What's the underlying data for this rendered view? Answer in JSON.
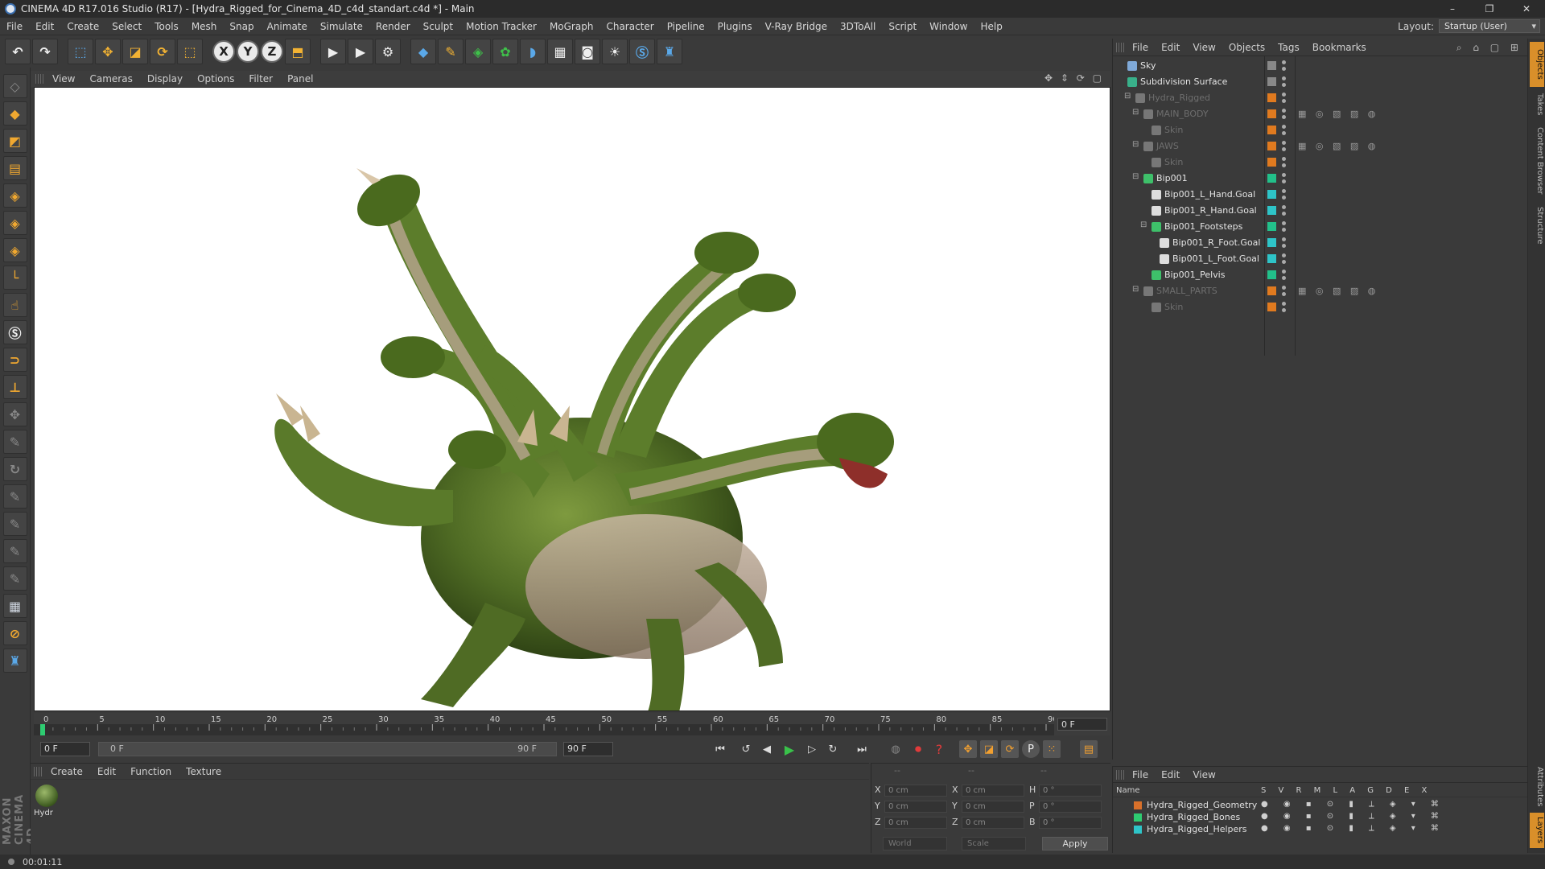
{
  "window": {
    "title": "CINEMA 4D R17.016 Studio (R17) - [Hydra_Rigged_for_Cinema_4D_c4d_standart.c4d *] - Main",
    "controls": [
      "–",
      "❐",
      "✕"
    ]
  },
  "menubar": {
    "items": [
      "File",
      "Edit",
      "Create",
      "Select",
      "Tools",
      "Mesh",
      "Snap",
      "Animate",
      "Simulate",
      "Render",
      "Sculpt",
      "Motion Tracker",
      "MoGraph",
      "Character",
      "Pipeline",
      "Plugins",
      "V-Ray Bridge",
      "3DToAll",
      "Script",
      "Window",
      "Help"
    ],
    "layout_label": "Layout:",
    "layout_value": "Startup (User)"
  },
  "toolbar": {
    "axis_x": "X",
    "axis_y": "Y",
    "axis_z": "Z"
  },
  "viewport": {
    "menu": [
      "View",
      "Cameras",
      "Display",
      "Options",
      "Filter",
      "Panel"
    ],
    "nav_icons": "✥ ⇕ ⟳ ▢"
  },
  "timeline": {
    "ticks": [
      "0",
      "5",
      "10",
      "15",
      "20",
      "25",
      "30",
      "35",
      "40",
      "45",
      "50",
      "55",
      "60",
      "65",
      "70",
      "75",
      "80",
      "85",
      "90"
    ],
    "end_frame": "0 F",
    "current_frame": "0 F",
    "range_start": "0 F",
    "range_end": "90 F",
    "max_frame": "90 F",
    "start_tick": 0,
    "end_tick": 90
  },
  "material_manager": {
    "menu": [
      "Create",
      "Edit",
      "Function",
      "Texture"
    ],
    "material_name": "Hydr"
  },
  "coordinates": {
    "rows": [
      {
        "a": "X",
        "av": "0 cm",
        "b": "X",
        "bv": "0 cm",
        "c": "H",
        "cv": "0 °"
      },
      {
        "a": "Y",
        "av": "0 cm",
        "b": "Y",
        "bv": "0 cm",
        "c": "P",
        "cv": "0 °"
      },
      {
        "a": "Z",
        "av": "0 cm",
        "b": "Z",
        "bv": "0 cm",
        "c": "B",
        "cv": "0 °"
      }
    ],
    "space": "World",
    "mode": "Scale",
    "apply": "Apply",
    "headers": [
      "--",
      "--",
      "--"
    ]
  },
  "objects": {
    "menu": [
      "File",
      "Edit",
      "View",
      "Objects",
      "Tags",
      "Bookmarks"
    ],
    "rows": [
      {
        "name": "Sky",
        "indent": 0,
        "dim": false,
        "color": "#7fa9d8",
        "tag": "#888888",
        "tags": ""
      },
      {
        "name": "Subdivision Surface",
        "indent": 0,
        "dim": false,
        "color": "#39b08a",
        "tag": "#888888",
        "tags": ""
      },
      {
        "name": "Hydra_Rigged",
        "indent": 1,
        "dim": true,
        "color": "#777777",
        "tag": "#e07a1f",
        "tags": ""
      },
      {
        "name": "MAIN_BODY",
        "indent": 2,
        "dim": true,
        "color": "#777777",
        "tag": "#e07a1f",
        "tags": "▦ ◎ ▧ ▨ ◍"
      },
      {
        "name": "Skin",
        "indent": 3,
        "dim": true,
        "color": "#777777",
        "tag": "#e07a1f",
        "tags": ""
      },
      {
        "name": "JAWS",
        "indent": 2,
        "dim": true,
        "color": "#777777",
        "tag": "#e07a1f",
        "tags": "▦ ◎ ▧ ▨ ◍"
      },
      {
        "name": "Skin",
        "indent": 3,
        "dim": true,
        "color": "#777777",
        "tag": "#e07a1f",
        "tags": ""
      },
      {
        "name": "Bip001",
        "indent": 2,
        "dim": false,
        "color": "#3ec06a",
        "tag": "#22c08a",
        "tags": ""
      },
      {
        "name": "Bip001_L_Hand.Goal",
        "indent": 3,
        "dim": false,
        "color": "#dddddd",
        "tag": "#2ec4c8",
        "tags": ""
      },
      {
        "name": "Bip001_R_Hand.Goal",
        "indent": 3,
        "dim": false,
        "color": "#dddddd",
        "tag": "#2ec4c8",
        "tags": ""
      },
      {
        "name": "Bip001_Footsteps",
        "indent": 3,
        "dim": false,
        "color": "#3ec06a",
        "tag": "#22c08a",
        "tags": ""
      },
      {
        "name": "Bip001_R_Foot.Goal",
        "indent": 4,
        "dim": false,
        "color": "#dddddd",
        "tag": "#2ec4c8",
        "tags": ""
      },
      {
        "name": "Bip001_L_Foot.Goal",
        "indent": 4,
        "dim": false,
        "color": "#dddddd",
        "tag": "#2ec4c8",
        "tags": ""
      },
      {
        "name": "Bip001_Pelvis",
        "indent": 3,
        "dim": false,
        "color": "#3ec06a",
        "tag": "#22c08a",
        "tags": ""
      },
      {
        "name": "SMALL_PARTS",
        "indent": 2,
        "dim": true,
        "color": "#777777",
        "tag": "#e07a1f",
        "tags": "▦ ◎ ▧ ▨ ◍"
      },
      {
        "name": "Skin",
        "indent": 3,
        "dim": true,
        "color": "#777777",
        "tag": "#e07a1f",
        "tags": ""
      }
    ]
  },
  "layers": {
    "menu": [
      "File",
      "Edit",
      "View"
    ],
    "header_name": "Name",
    "header_cols": "S V R M L A G D E X",
    "rows": [
      {
        "name": "Hydra_Rigged_Geometry",
        "color": "#d8702a"
      },
      {
        "name": "Hydra_Rigged_Bones",
        "color": "#2ecc71"
      },
      {
        "name": "Hydra_Rigged_Helpers",
        "color": "#2ec4c8"
      }
    ]
  },
  "right_tabs": [
    "Objects",
    "Takes",
    "Content Browser",
    "Structure",
    "Attributes",
    "Layers"
  ],
  "status": {
    "time": "00:01:11"
  }
}
